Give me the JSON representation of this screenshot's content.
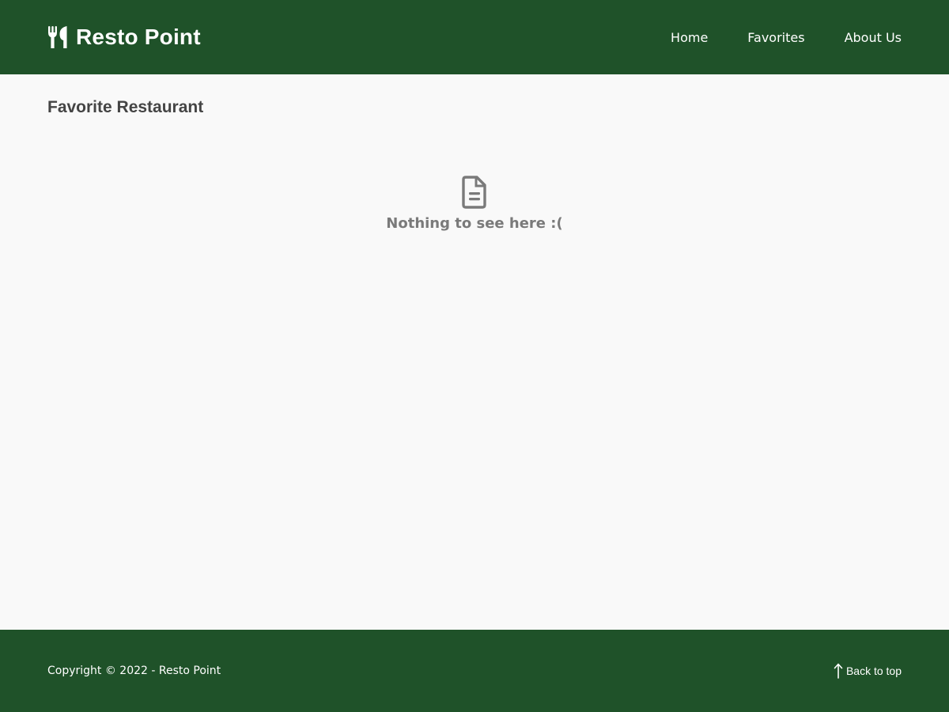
{
  "header": {
    "brand": "Resto Point",
    "brand_icon": "utensils-icon",
    "nav": [
      {
        "label": "Home"
      },
      {
        "label": "Favorites"
      },
      {
        "label": "About Us"
      }
    ]
  },
  "main": {
    "title": "Favorite Restaurant",
    "empty_state": {
      "icon": "document-icon",
      "message": "Nothing to see here :("
    }
  },
  "footer": {
    "copyright": "Copyright © 2022 - Resto Point",
    "back_to_top": "Back to top",
    "back_to_top_icon": "arrow-up-icon"
  },
  "colors": {
    "primary": "#1f5229",
    "background": "#f9f9f9",
    "text": "#444444",
    "muted": "#7a7a7a"
  }
}
